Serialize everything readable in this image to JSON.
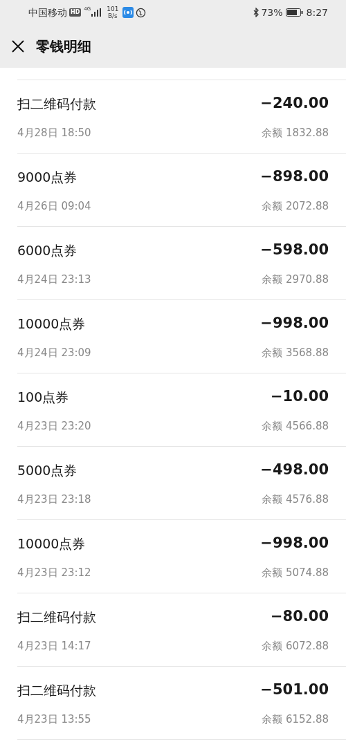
{
  "status_bar": {
    "carrier": "中国移动",
    "hd": "HD",
    "network": "4G",
    "speed_value": "101",
    "speed_unit": "B/s",
    "battery": "73%",
    "time": "8:27"
  },
  "header": {
    "title": "零钱明细"
  },
  "transactions": [
    {
      "title": "扫二维码付款",
      "amount": "−240.00",
      "time": "4月28日 18:50",
      "balance": "余额 1832.88"
    },
    {
      "title": "9000点券",
      "amount": "−898.00",
      "time": "4月26日 09:04",
      "balance": "余额 2072.88"
    },
    {
      "title": "6000点券",
      "amount": "−598.00",
      "time": "4月24日 23:13",
      "balance": "余额 2970.88"
    },
    {
      "title": "10000点券",
      "amount": "−998.00",
      "time": "4月24日 23:09",
      "balance": "余额 3568.88"
    },
    {
      "title": "100点券",
      "amount": "−10.00",
      "time": "4月23日 23:20",
      "balance": "余额 4566.88"
    },
    {
      "title": "5000点券",
      "amount": "−498.00",
      "time": "4月23日 23:18",
      "balance": "余额 4576.88"
    },
    {
      "title": "10000点券",
      "amount": "−998.00",
      "time": "4月23日 23:12",
      "balance": "余额 5074.88"
    },
    {
      "title": "扫二维码付款",
      "amount": "−80.00",
      "time": "4月23日 14:17",
      "balance": "余额 6072.88"
    },
    {
      "title": "扫二维码付款",
      "amount": "−501.00",
      "time": "4月23日 13:55",
      "balance": "余额 6152.88"
    }
  ]
}
